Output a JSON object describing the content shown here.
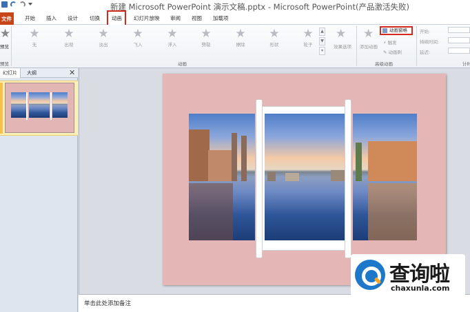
{
  "window": {
    "title": "新建 Microsoft PowerPoint 演示文稿.pptx - Microsoft PowerPoint(产品激活失败)"
  },
  "ribbon_tabs": [
    {
      "label": "文件",
      "active": false
    },
    {
      "label": "开始",
      "active": false
    },
    {
      "label": "插入",
      "active": false
    },
    {
      "label": "设计",
      "active": false
    },
    {
      "label": "切换",
      "active": false
    },
    {
      "label": "动画",
      "active": true
    },
    {
      "label": "幻灯片放映",
      "active": false
    },
    {
      "label": "审阅",
      "active": false
    },
    {
      "label": "视图",
      "active": false
    },
    {
      "label": "加载项",
      "active": false
    }
  ],
  "ribbon": {
    "preview": {
      "label": "预览",
      "group": "预览"
    },
    "animation_effects": [
      "无",
      "出现",
      "淡出",
      "飞入",
      "浮入",
      "劈裂",
      "擦除",
      "形状",
      "轮子"
    ],
    "effect_options": "效果选项",
    "animation_group": "动画",
    "add_animation": "添加动画",
    "animation_pane": "动画窗格",
    "trigger": "触发",
    "animation_painter": "动画刷",
    "advanced_group": "高级动画",
    "timing": {
      "start": "开始:",
      "duration": "持续时间:",
      "delay": "延迟:",
      "group": "计时"
    }
  },
  "left_pane": {
    "tab_slides": "幻灯片",
    "tab_outline": "大纲",
    "close": "✕",
    "slide_number": "1"
  },
  "notes_placeholder": "单击此处添加备注",
  "watermark": {
    "title": "查询啦",
    "domain": "chaxunla.com"
  }
}
